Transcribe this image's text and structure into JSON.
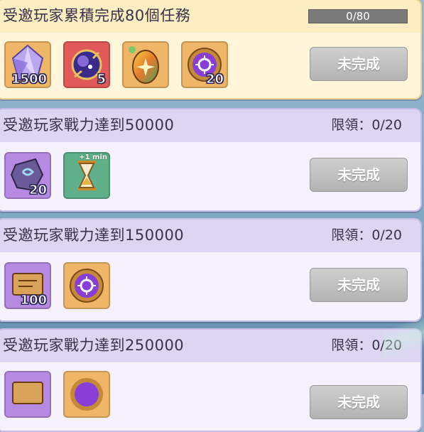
{
  "tasks": [
    {
      "title": "受邀玩家累積完成80個任務",
      "progress_text": "0/80",
      "progress_value": 0,
      "button_label": "未完成",
      "rewards": [
        {
          "icon": "crystal-gem-icon",
          "qty": "1500"
        },
        {
          "icon": "galaxy-orb-icon",
          "qty": "5"
        },
        {
          "icon": "rainbow-egg-icon",
          "qty": ""
        },
        {
          "icon": "purple-rune-token-icon",
          "qty": "20"
        }
      ]
    },
    {
      "title": "受邀玩家戰力達到50000",
      "limit_text": "限領：0/20",
      "button_label": "未完成",
      "rewards": [
        {
          "icon": "rune-stone-icon",
          "qty": "20"
        },
        {
          "icon": "hourglass-icon",
          "qty": "",
          "tag": "+1 min"
        }
      ]
    },
    {
      "title": "受邀玩家戰力達到150000",
      "limit_text": "限領：0/20",
      "button_label": "未完成",
      "rewards": [
        {
          "icon": "scroll-icon",
          "qty": "100"
        },
        {
          "icon": "purple-rune-token-icon",
          "qty": ""
        }
      ]
    },
    {
      "title": "受邀玩家戰力達到250000",
      "limit_text": "限領：0/20",
      "button_label": "未完成",
      "rewards": [
        {
          "icon": "scroll-icon",
          "qty": ""
        },
        {
          "icon": "purple-rune-token-icon",
          "qty": ""
        }
      ]
    }
  ]
}
